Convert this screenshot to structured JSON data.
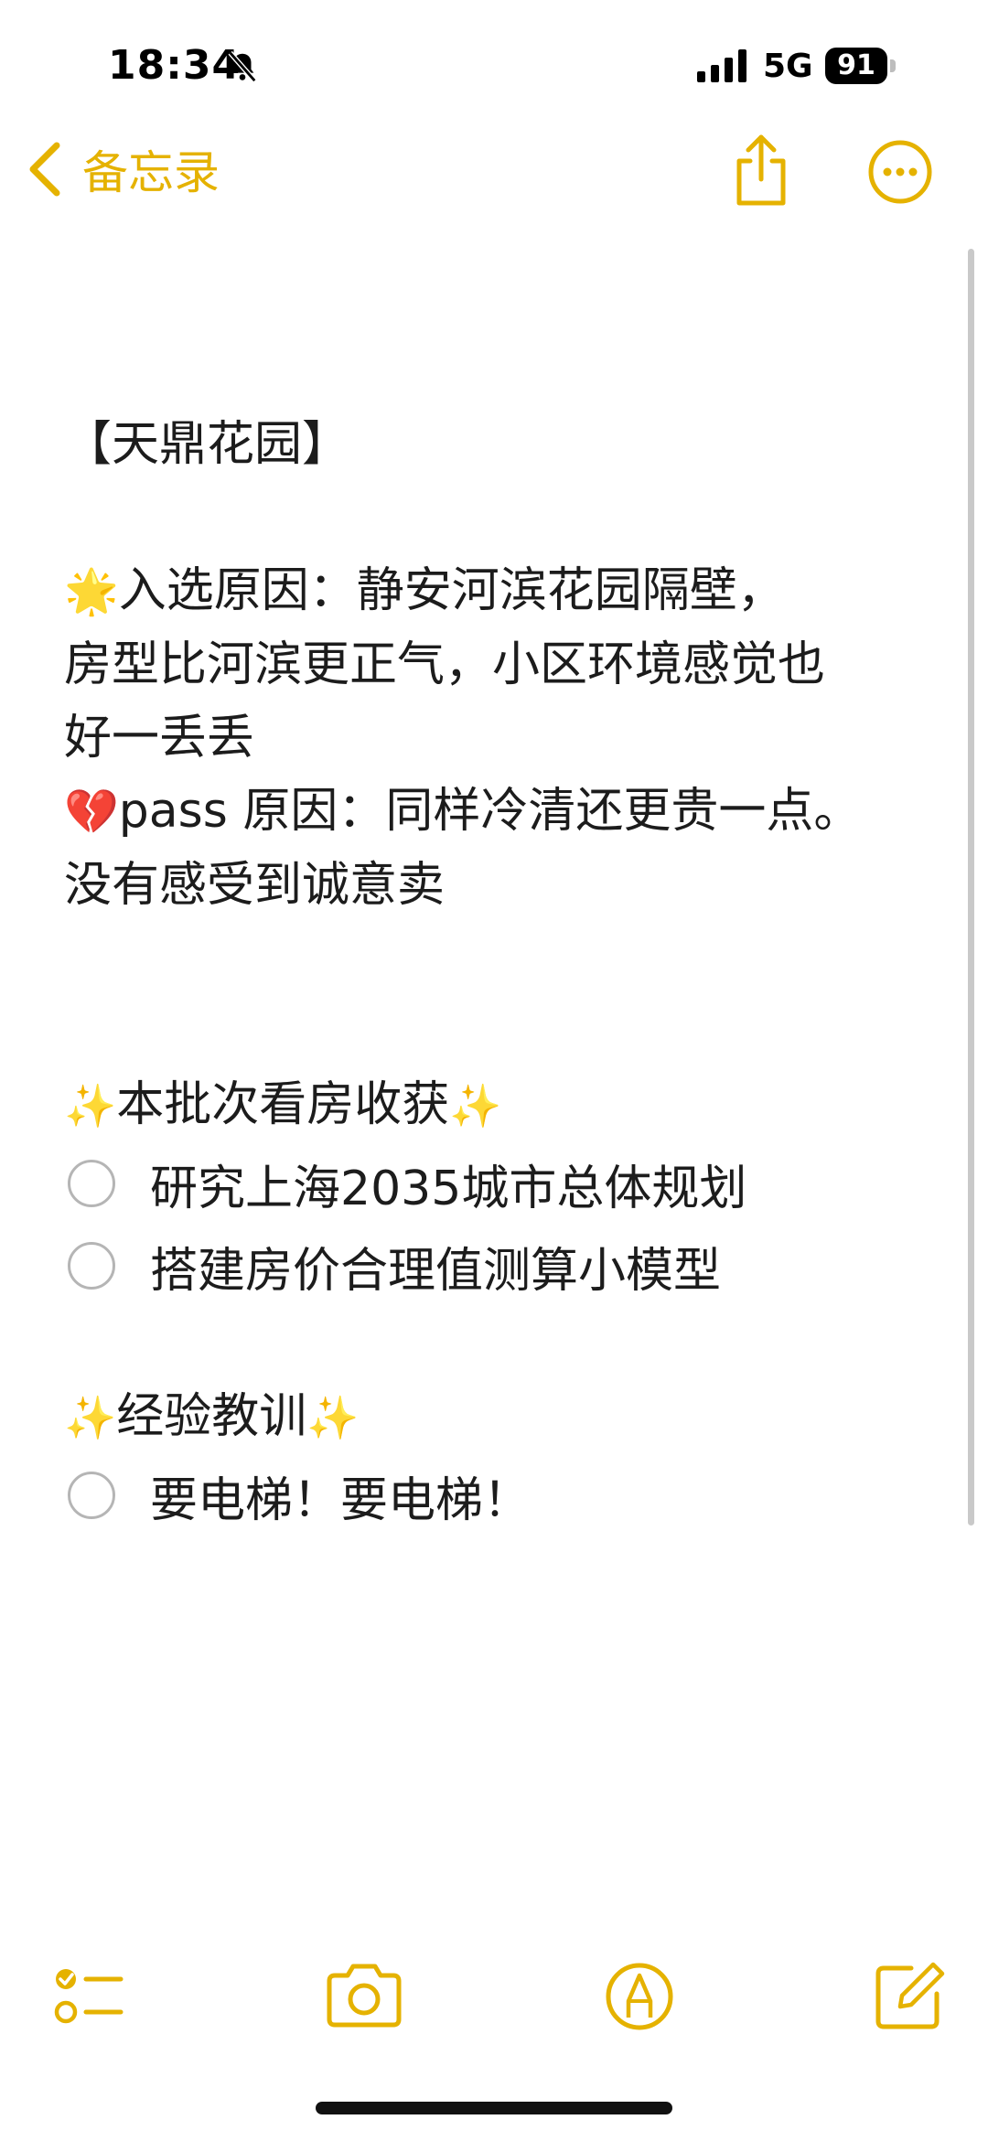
{
  "status_bar": {
    "time": "18:34",
    "network": "5G",
    "battery": "91",
    "icons": [
      "bell-slash-icon",
      "signal-bars-icon",
      "battery-icon"
    ]
  },
  "nav": {
    "back_label": "备忘录",
    "icons": [
      "chevron-left-icon",
      "share-icon",
      "more-icon"
    ],
    "accent_color": "#e5b200"
  },
  "note": {
    "title": "【天鼎花园】",
    "reason_in_emoji": "🌟",
    "reason_in_line1": "入选原因：静安河滨花园隔壁，",
    "reason_in_line2": "房型比河滨更正气，小区环境感觉也",
    "reason_in_line3": "好一丢丢",
    "reason_out_emoji": "💔",
    "reason_out_line1": "pass 原因：同样冷清还更贵一点。",
    "reason_out_line2": "没有感受到诚意卖",
    "section1_sparkle": "✨",
    "section1_title": "本批次看房收获",
    "section1_items": [
      "研究上海2035城市总体规划",
      "搭建房价合理值测算小模型"
    ],
    "section2_sparkle": "✨",
    "section2_title": "经验教训",
    "section2_items": [
      "要电梯！要电梯！"
    ]
  },
  "toolbar": {
    "icons": [
      "checklist-icon",
      "camera-icon",
      "markup-pen-icon",
      "compose-icon"
    ]
  }
}
